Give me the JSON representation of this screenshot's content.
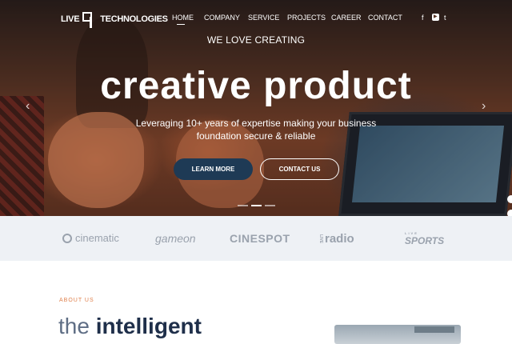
{
  "header": {
    "logo_left": "LIVE",
    "logo_right": "TECHNOLOGIES",
    "nav": [
      "HOME",
      "COMPANY",
      "SERVICE",
      "PROJECTS",
      "CAREER",
      "CONTACT"
    ],
    "active_nav": "HOME",
    "social_icons": [
      "facebook-icon",
      "youtube-icon",
      "twitter-icon"
    ],
    "social_glyphs": [
      "f",
      "▶",
      "t"
    ]
  },
  "hero": {
    "tagline": "WE LOVE CREATING",
    "headline": "creative product",
    "subline_1": "Leveraging 10+ years of expertise making your business",
    "subline_2": "foundation secure & reliable",
    "learn_more": "LEARN MORE",
    "contact_us": "CONTACT US",
    "prev_arrow": "‹",
    "next_arrow": "›",
    "slide_count": 3,
    "active_slide": 2
  },
  "clients": {
    "cinematic": "cinematic",
    "gameon": "gameon",
    "cinespot": "CINESPOT",
    "radio_small": "LIVE",
    "radio": "radio",
    "sports_top": "LIVE",
    "sports": "SPORTS"
  },
  "about": {
    "eyebrow": "ABOUT US",
    "title_light": "the",
    "title_bold": "intelligent"
  },
  "colors": {
    "accent": "#e0824e",
    "primary_button": "#1e3a55",
    "heading_dark": "#1f2f4a",
    "strip_bg": "#eef1f5"
  }
}
